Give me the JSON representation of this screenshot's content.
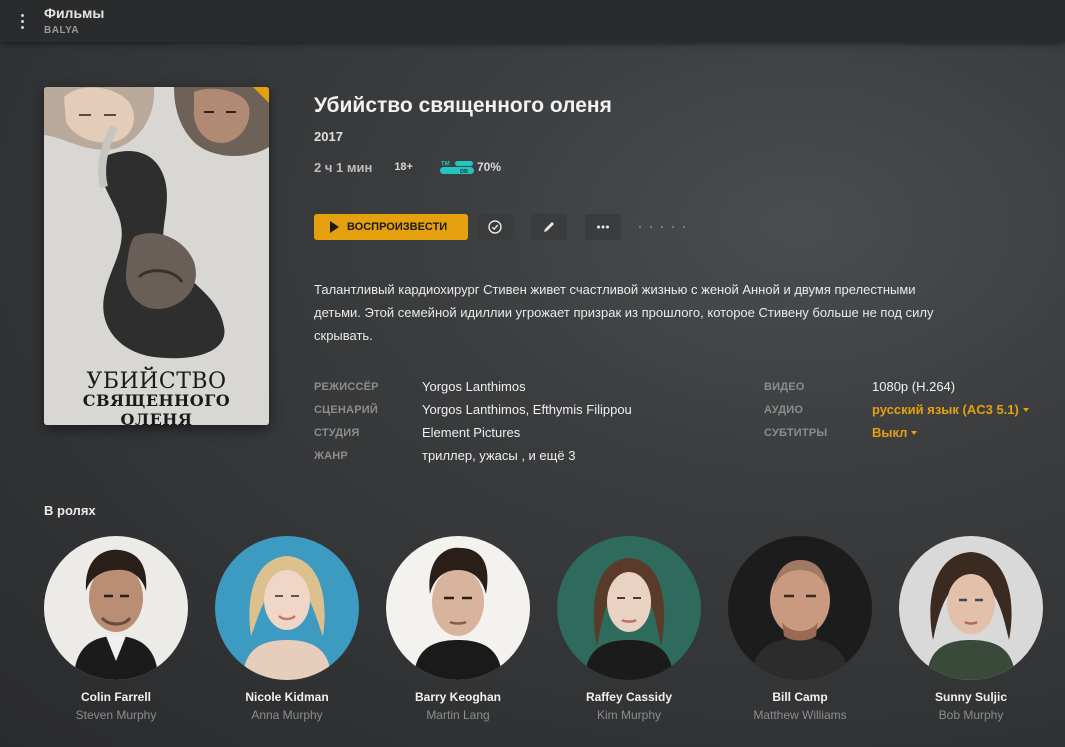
{
  "header": {
    "title": "Фильмы",
    "subtitle": "BALYA"
  },
  "poster": {
    "title_line1": "УБИЙСТВО",
    "title_line2": "СВЯЩЕННОГО ОЛЕНЯ"
  },
  "movie": {
    "title": "Убийство священного оленя",
    "year": "2017",
    "duration": "2 ч 1 мин",
    "age_rating": "18+",
    "tmdb_logo_text_top": "TM",
    "tmdb_logo_text_bottom": "DB",
    "tmdb_score": "70%",
    "description": "Талантливый кардиохирург Стивен живет счастливой жизнью с женой Анной и двумя прелестными детьми. Этой семейной идиллии угрожает призрак из прошлого, которое Стивену больше не под силу скрывать."
  },
  "actions": {
    "play_label": "ВОСПРОИЗВЕСТИ"
  },
  "details_left": [
    {
      "label": "РЕЖИССЁР",
      "value": "Yorgos Lanthimos"
    },
    {
      "label": "СЦЕНАРИЙ",
      "value": "Yorgos Lanthimos, Efthymis Filippou"
    },
    {
      "label": "СТУДИЯ",
      "value": "Element Pictures"
    },
    {
      "label": "ЖАНР",
      "value": "триллер, ужасы , и ещё 3"
    }
  ],
  "details_right": [
    {
      "label": "ВИДЕО",
      "value": "1080p (H.264)"
    },
    {
      "label": "АУДИО",
      "value": "русский язык (AC3 5.1)"
    },
    {
      "label": "СУБТИТРЫ",
      "value": "Выкл"
    }
  ],
  "cast_heading": "В ролях",
  "cast": [
    {
      "name": "Colin Farrell",
      "role": "Steven Murphy"
    },
    {
      "name": "Nicole Kidman",
      "role": "Anna Murphy"
    },
    {
      "name": "Barry Keoghan",
      "role": "Martin Lang"
    },
    {
      "name": "Raffey Cassidy",
      "role": "Kim Murphy"
    },
    {
      "name": "Bill Camp",
      "role": "Matthew Williams"
    },
    {
      "name": "Sunny Suljic",
      "role": "Bob Murphy"
    }
  ],
  "colors": {
    "accent": "#e5a00d",
    "background": "#3a3c3e",
    "topbar": "#2a2b2c",
    "tmdb": "#21c6c0"
  },
  "icons": [
    "menu-icon",
    "play-icon",
    "check-circle-icon",
    "pencil-icon",
    "more-icon",
    "tmdb-logo-icon"
  ]
}
